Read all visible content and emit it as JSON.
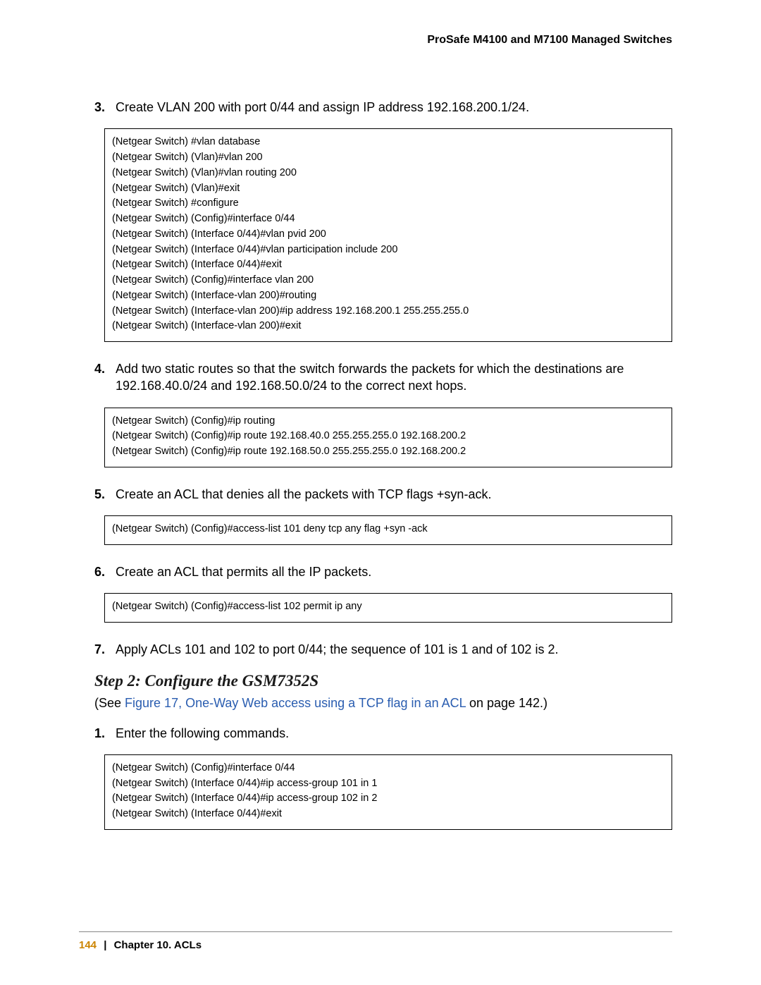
{
  "header": {
    "title": "ProSafe M4100 and M7100 Managed Switches"
  },
  "steps": {
    "s3": {
      "num": "3.",
      "text": "Create VLAN 200 with port 0/44 and assign IP address 192.168.200.1/24."
    },
    "s4": {
      "num": "4.",
      "text": "Add two static routes so that the switch forwards the packets for which the destinations are 192.168.40.0/24 and 192.168.50.0/24 to the correct next hops."
    },
    "s5": {
      "num": "5.",
      "text": "Create an ACL that denies all the packets with TCP flags +syn-ack."
    },
    "s6": {
      "num": "6.",
      "text": "Create an ACL that permits all the IP packets."
    },
    "s7": {
      "num": "7.",
      "text": "Apply ACLs 101 and 102 to port 0/44; the sequence of 101 is 1 and of 102 is 2."
    },
    "s1b": {
      "num": "1.",
      "text": "Enter the following commands."
    }
  },
  "code": {
    "block1": "(Netgear Switch) #vlan database\n(Netgear Switch) (Vlan)#vlan 200\n(Netgear Switch) (Vlan)#vlan routing 200\n(Netgear Switch) (Vlan)#exit\n(Netgear Switch) #configure\n(Netgear Switch) (Config)#interface 0/44\n(Netgear Switch) (Interface 0/44)#vlan pvid 200\n(Netgear Switch) (Interface 0/44)#vlan participation include 200\n(Netgear Switch) (Interface 0/44)#exit\n(Netgear Switch) (Config)#interface vlan 200\n(Netgear Switch) (Interface-vlan 200)#routing\n(Netgear Switch) (Interface-vlan 200)#ip address 192.168.200.1 255.255.255.0\n(Netgear Switch) (Interface-vlan 200)#exit",
    "block2": "(Netgear Switch) (Config)#ip routing\n(Netgear Switch) (Config)#ip route 192.168.40.0 255.255.255.0 192.168.200.2\n(Netgear Switch) (Config)#ip route 192.168.50.0 255.255.255.0 192.168.200.2",
    "block3": "(Netgear Switch) (Config)#access-list 101 deny tcp any flag +syn -ack",
    "block4": "(Netgear Switch) (Config)#access-list 102 permit ip any",
    "block5": "(Netgear Switch) (Config)#interface 0/44\n(Netgear Switch) (Interface 0/44)#ip access-group 101 in 1\n(Netgear Switch) (Interface 0/44)#ip access-group 102 in 2\n(Netgear Switch) (Interface 0/44)#exit"
  },
  "section2": {
    "heading": "Step 2: Configure the GSM7352S",
    "desc_prefix": "(See ",
    "link_text": "Figure 17, One-Way Web access using a TCP flag in an ACL",
    "desc_suffix": " on page 142.)"
  },
  "footer": {
    "page_num": "144",
    "separator": "|",
    "chapter": "Chapter 10.  ACLs"
  }
}
